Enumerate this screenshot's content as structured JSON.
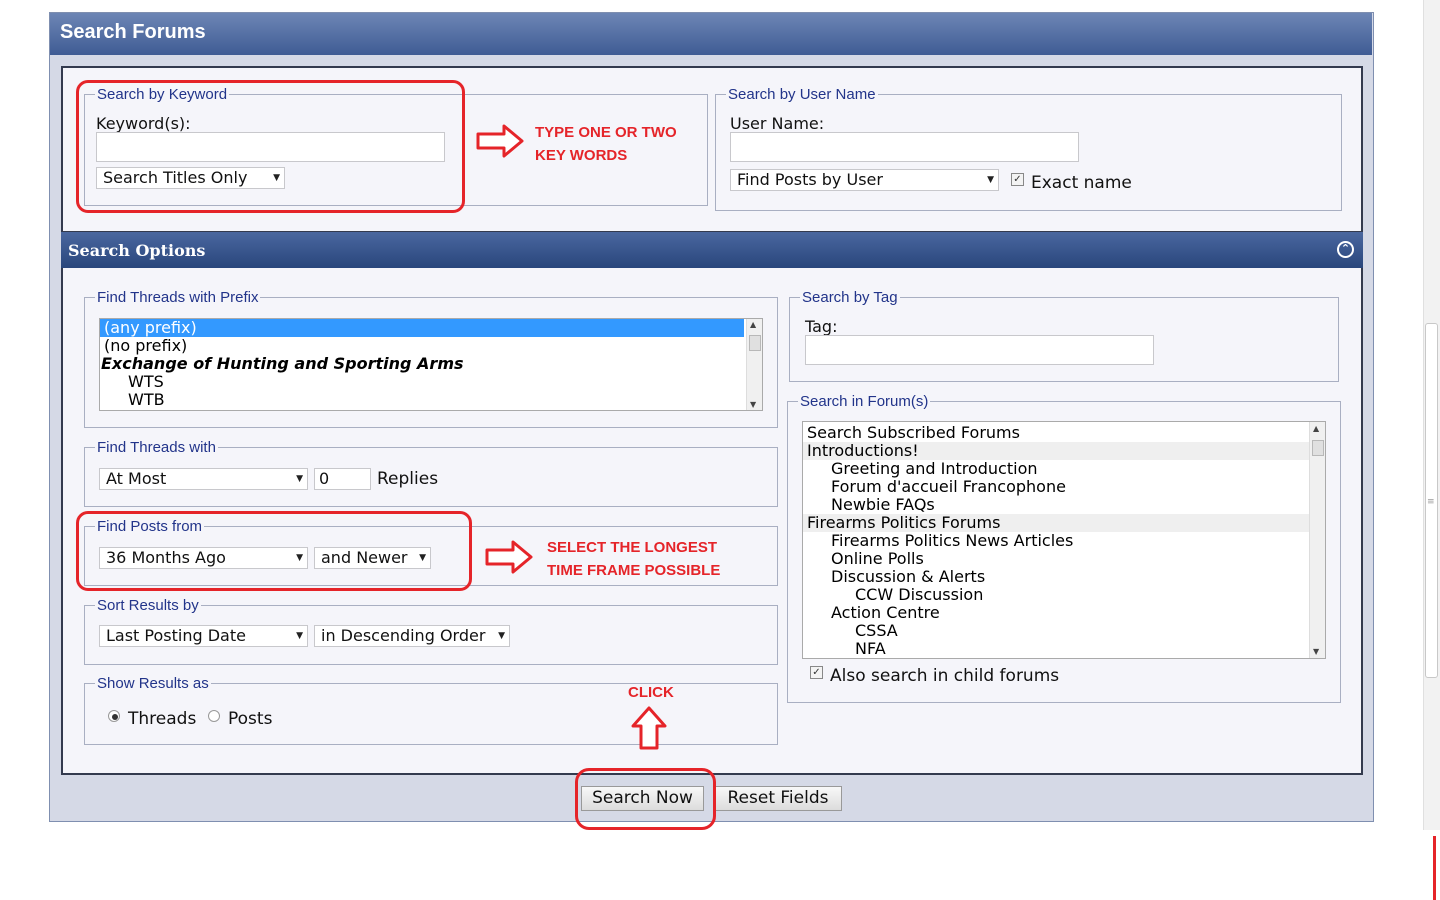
{
  "panel": {
    "title": "Search Forums"
  },
  "keyword": {
    "legend": "Search by Keyword",
    "label": "Keyword(s):",
    "value": "",
    "scope_selected": "Search Titles Only"
  },
  "user": {
    "legend": "Search by User Name",
    "label": "User Name:",
    "value": "",
    "mode_selected": "Find Posts by User",
    "exact_label": "Exact name",
    "exact_checked": true
  },
  "options": {
    "title": "Search Options"
  },
  "prefix": {
    "legend": "Find Threads with Prefix",
    "items": [
      "(any prefix)",
      "(no prefix)",
      "Exchange of Hunting and Sporting Arms",
      "WTS",
      "WTB"
    ]
  },
  "tag": {
    "legend": "Search by Tag",
    "label": "Tag:",
    "value": ""
  },
  "forums": {
    "legend": "Search in Forum(s)",
    "items": [
      "Search Subscribed Forums",
      "Introductions!",
      "Greeting and Introduction",
      "Forum d'accueil Francophone",
      "Newbie FAQs",
      "Firearms Politics Forums",
      "Firearms Politics News Articles",
      "Online Polls",
      "Discussion & Alerts",
      "CCW Discussion",
      "Action Centre",
      "CSSA",
      "NFA"
    ],
    "child_label": "Also search in child forums",
    "child_checked": true
  },
  "replies": {
    "legend": "Find Threads with",
    "compare_selected": "At Most",
    "value": "0",
    "suffix": "Replies"
  },
  "posts_from": {
    "legend": "Find Posts from",
    "period_selected": "36 Months Ago",
    "direction_selected": "and Newer"
  },
  "sort": {
    "legend": "Sort Results by",
    "field_selected": "Last Posting Date",
    "order_selected": "in Descending Order"
  },
  "show": {
    "legend": "Show Results as",
    "threads_label": "Threads",
    "posts_label": "Posts",
    "selected": "Threads"
  },
  "buttons": {
    "search": "Search Now",
    "reset": "Reset Fields"
  },
  "annotations": {
    "keyword_line1": "TYPE ONE OR TWO",
    "keyword_line2": "KEY WORDS",
    "time_line1": "SELECT THE LONGEST",
    "time_line2": "TIME FRAME POSSIBLE",
    "click": "CLICK",
    "color": "#e52429"
  },
  "colors": {
    "header": "#3f5c94",
    "legend": "#22348a",
    "highlight": "#3399ff"
  }
}
